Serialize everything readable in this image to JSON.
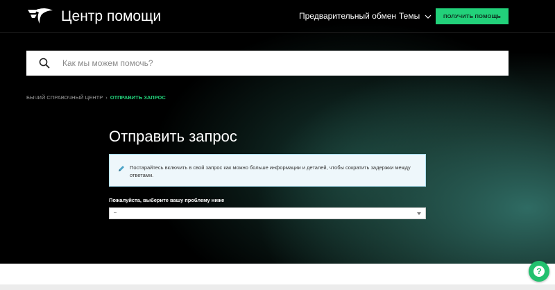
{
  "header": {
    "logo_text": "Центр помощи",
    "nav": {
      "exchange": "Предварительный обмен",
      "topics": "Темы"
    },
    "help_button": "ПОЛУЧИТЬ ПОМОЩЬ"
  },
  "search": {
    "placeholder": "Как мы можем помочь?"
  },
  "breadcrumb": {
    "items": [
      "БЫЧИЙ СПРАВОЧНЫЙ ЦЕНТР",
      "ОТПРАВИТЬ ЗАПРОС"
    ],
    "separator": "›"
  },
  "main": {
    "title": "Отправить запрос",
    "notice": "Постарайтесь включить в свой запрос как можно больше информации и деталей, чтобы сократить задержки между ответами.",
    "select_label": "Пожалуйста, выберите вашу проблему ниже",
    "select_value": "–"
  },
  "chat_widget": {
    "icon_text": "?"
  },
  "colors": {
    "accent": "#22d17a",
    "background": "#000000",
    "notice_bg": "#eef7fb",
    "notice_border": "#aee0f0"
  },
  "icons": [
    "logo-icon",
    "chevron-down-icon",
    "search-icon",
    "pencil-icon",
    "dropdown-arrow-icon",
    "help-chat-icon"
  ]
}
